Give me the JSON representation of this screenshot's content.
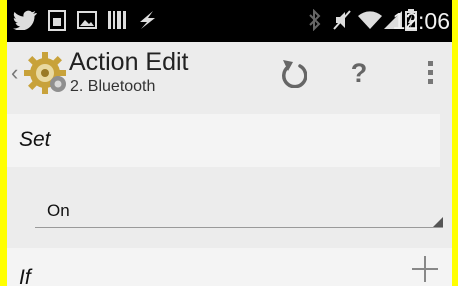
{
  "status_bar": {
    "time": "12:06",
    "left_icons": [
      "twitter-icon",
      "sim-icon",
      "image-icon",
      "barcode-icon",
      "lightning-icon"
    ],
    "right_icons": [
      "bluetooth-icon",
      "mute-icon",
      "wifi-icon",
      "signal-icon",
      "battery-icon"
    ]
  },
  "action_bar": {
    "title": "Action Edit",
    "subtitle": "2. Bluetooth",
    "up_caret": "‹",
    "help_label": "?",
    "icons": [
      "tasker-app-icon",
      "revert-icon",
      "help-icon",
      "overflow-menu-icon"
    ]
  },
  "content": {
    "set_label": "Set",
    "set_value": "On",
    "if_label": "If"
  },
  "colors": {
    "frame": "#ffff00",
    "status_bar": "#000000",
    "background": "#ececec",
    "section": "#f4f4f4"
  }
}
